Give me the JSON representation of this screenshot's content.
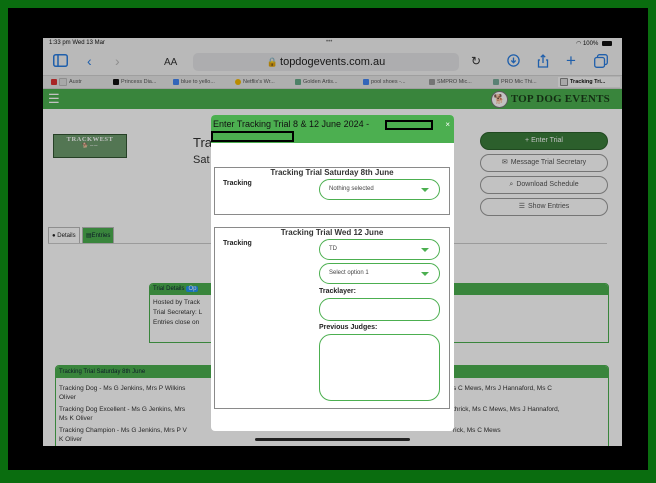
{
  "status_bar": {
    "time": "1:33 pm  Wed 13 Mar",
    "dots": "•••",
    "battery": "100%"
  },
  "browser": {
    "aa_label": "AA",
    "url": "topdogevents.com.au"
  },
  "browser_tabs": [
    "Austr",
    "Princess Dia...",
    "blue to yello...",
    "Netflix's Wr...",
    "Golden Artis...",
    "pool shoes -...",
    "SMPRO Mic...",
    "PRO Mic Thi...",
    "Tracking Tri..."
  ],
  "site": {
    "brand": "TOP DOG EVENTS"
  },
  "page": {
    "club_logo_text": "TRACKWEST",
    "title_fragment": "Tra",
    "subtitle_fragment": "Sat",
    "actions": {
      "enter_trial": "+ Enter Trial",
      "message_secretary": "Message Trial Secretary",
      "download_schedule": "Download Schedule",
      "show_entries": "Show Entries"
    },
    "tabs": {
      "details": "Details",
      "entries": "Entries"
    },
    "trial_details": {
      "heading": "Trial Details",
      "badge": "Op",
      "lines": [
        "Hosted by Track",
        "Trial Secretary: L",
        "Entries close on"
      ]
    },
    "saturday": {
      "heading": "Tracking Trial Saturday 8th June",
      "left_lines": [
        "Tracking Dog - Ms G Jenkins, Mrs P Wilkins",
        "Oliver",
        "Tracking Dog Excellent - Ms G Jenkins, Mrs",
        "Ms K Oliver",
        "Tracking Champion - Ms G Jenkins, Mrs P V",
        "K Oliver"
      ],
      "right_lines": [
        "s C Mews, Mrs J Hannaford, Ms C",
        "thrick, Ms C Mews, Mrs J Hannaford,",
        "rick, Ms C Mews"
      ]
    }
  },
  "modal": {
    "title": "Enter Tracking Trial 8 & 12 June 2024 -",
    "close": "×",
    "section1": {
      "legend": "Tracking Trial Saturday 8th June",
      "label": "Tracking",
      "selected": "Nothing selected"
    },
    "section2": {
      "legend": "Tracking Trial Wed 12 June",
      "label": "Tracking",
      "selected": "TD",
      "option_placeholder": "Select option 1",
      "tracklayer_label": "Tracklayer:",
      "tracklayer_value": "",
      "previous_judges_label": "Previous Judges:",
      "previous_judges_value": ""
    }
  },
  "colors": {
    "accent": "#4caf50",
    "dark_green": "#3a7d3a",
    "outer_bg": "#0a6d0f",
    "link_blue": "#2a7de1"
  }
}
